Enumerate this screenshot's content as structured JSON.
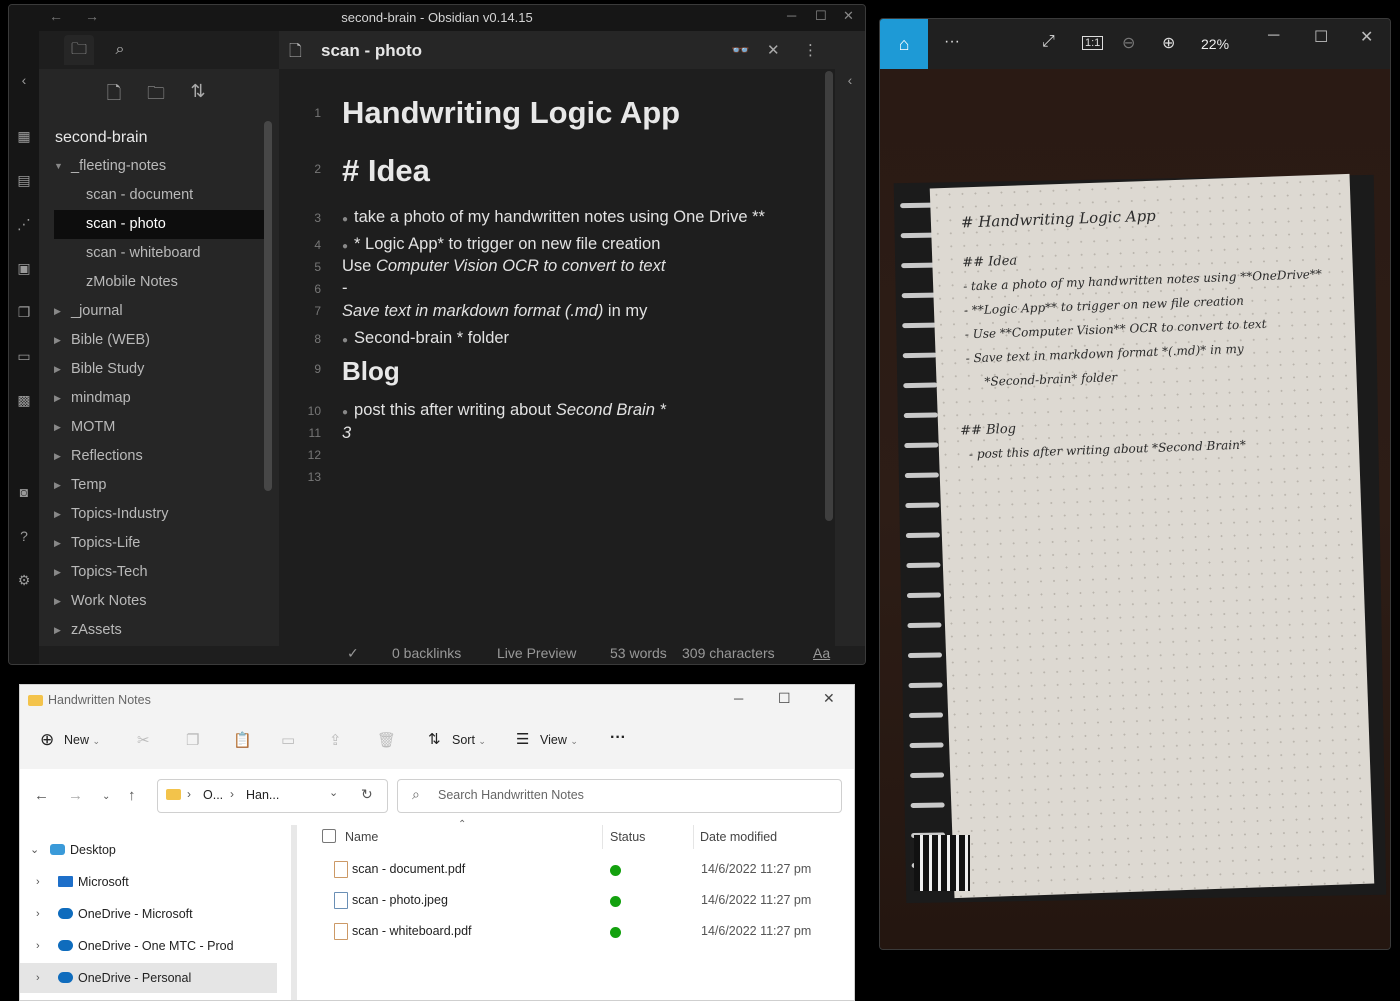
{
  "obsidian": {
    "window_title": "second-brain - Obsidian v0.14.15",
    "vault_name": "second-brain",
    "tree": [
      {
        "label": "_fleeting-notes",
        "expanded": true,
        "child": false
      },
      {
        "label": "scan - document",
        "child": true
      },
      {
        "label": "scan - photo",
        "child": true,
        "active": true
      },
      {
        "label": "scan - whiteboard",
        "child": true
      },
      {
        "label": "zMobile Notes",
        "child": true
      },
      {
        "label": "_journal",
        "child": false
      },
      {
        "label": "Bible (WEB)",
        "child": false
      },
      {
        "label": "Bible Study",
        "child": false
      },
      {
        "label": "mindmap",
        "child": false
      },
      {
        "label": "MOTM",
        "child": false
      },
      {
        "label": "Reflections",
        "child": false
      },
      {
        "label": "Temp",
        "child": false
      },
      {
        "label": "Topics-Industry",
        "child": false
      },
      {
        "label": "Topics-Life",
        "child": false
      },
      {
        "label": "Topics-Tech",
        "child": false
      },
      {
        "label": "Work Notes",
        "child": false
      },
      {
        "label": "zAssets",
        "child": false
      }
    ],
    "tab_title": "scan - photo",
    "editor": {
      "line_numbers": [
        "1",
        "2",
        "3",
        "4",
        "5",
        "6",
        "7",
        "8",
        "9",
        "10",
        "11",
        "12",
        "13"
      ],
      "l1": "Handwriting Logic App",
      "l2": "# Idea",
      "l3": "take a photo of my handwritten notes using One Drive **",
      "l4": "* Logic App* to trigger on new file creation",
      "l5_a": "Use ",
      "l5_b": "Computer Vision OCR to convert to text",
      "l6": "-",
      "l7_a": "Save text in markdown format (.md)",
      "l7_b": " in my",
      "l8": "Second-brain * folder",
      "l9": "Blog",
      "l10_a": "post this after writing about ",
      "l10_b": "Second Brain *",
      "l11": "3"
    },
    "status": {
      "backlinks": "0 backlinks",
      "mode": "Live Preview",
      "words": "53 words",
      "characters": "309 characters",
      "font_toggle": "Aa"
    }
  },
  "photos": {
    "zoom": "22%",
    "handwriting": [
      "# Handwriting Logic App",
      "## Idea",
      "- take a photo of my handwritten notes using **OneDrive**",
      "- **Logic App** to trigger on new file creation",
      "- Use **Computer Vision** OCR to convert to text",
      "- Save text in markdown format *(.md)* in my",
      "*Second-brain* folder",
      "## Blog",
      "- post this after writing about *Second Brain*"
    ]
  },
  "explorer": {
    "window_title": "Handwritten Notes",
    "toolbar": {
      "new": "New",
      "sort": "Sort",
      "view": "View",
      "more": "···"
    },
    "address": {
      "part1": "O...",
      "part2": "Han..."
    },
    "search_placeholder": "Search Handwritten Notes",
    "tree": [
      {
        "label": "Desktop"
      },
      {
        "label": "Microsoft"
      },
      {
        "label": "OneDrive - Microsoft"
      },
      {
        "label": "OneDrive - One MTC - Prod"
      },
      {
        "label": "OneDrive - Personal"
      }
    ],
    "columns": {
      "name": "Name",
      "status": "Status",
      "date": "Date modified"
    },
    "files": [
      {
        "name": "scan - document.pdf",
        "date": "14/6/2022 11:27 pm"
      },
      {
        "name": "scan - photo.jpeg",
        "date": "14/6/2022 11:27 pm"
      },
      {
        "name": "scan - whiteboard.pdf",
        "date": "14/6/2022 11:27 pm"
      }
    ]
  },
  "colors": {
    "accent": "#1e9ad6",
    "status_ok": "#13a10e",
    "folder": "#f3c34b"
  }
}
